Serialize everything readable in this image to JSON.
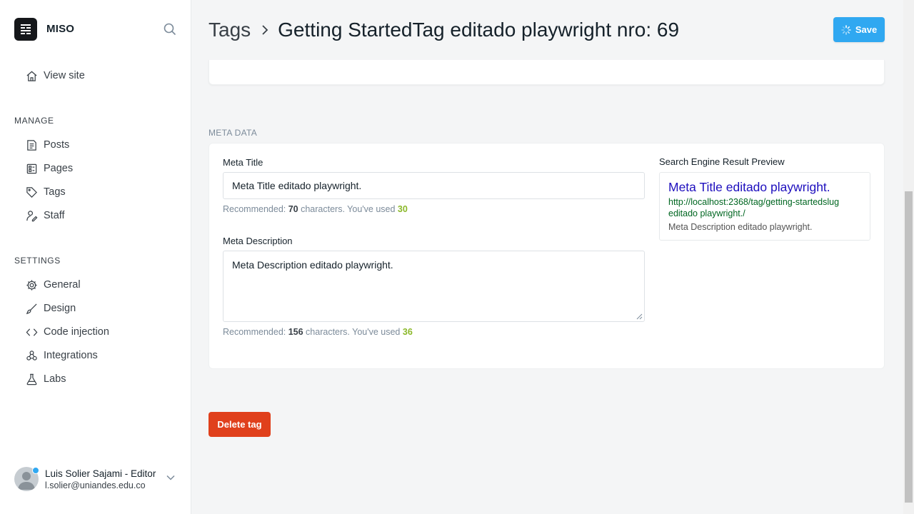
{
  "brand": {
    "name": "MISO"
  },
  "nav": {
    "view_site": "View site",
    "manage_label": "MANAGE",
    "manage_items": [
      "Posts",
      "Pages",
      "Tags",
      "Staff"
    ],
    "settings_label": "SETTINGS",
    "settings_items": [
      "General",
      "Design",
      "Code injection",
      "Integrations",
      "Labs"
    ]
  },
  "user": {
    "name": "Luis Solier Sajami - Editor",
    "email": "l.solier@uniandes.edu.co"
  },
  "header": {
    "crumb": "Tags",
    "title": "Getting StartedTag editado playwright nro: 69",
    "save_label": "Save"
  },
  "meta": {
    "section_label": "META DATA",
    "title_label": "Meta Title",
    "title_value": "Meta Title editado playwright.",
    "title_hint_prefix": "Recommended: ",
    "title_hint_rec": "70",
    "title_hint_mid": " characters. You've used ",
    "title_hint_used": "30",
    "desc_label": "Meta Description",
    "desc_value": "Meta Description editado playwright.",
    "desc_hint_prefix": "Recommended: ",
    "desc_hint_rec": "156",
    "desc_hint_mid": " characters. You've used ",
    "desc_hint_used": "36"
  },
  "preview": {
    "label": "Search Engine Result Preview",
    "title": "Meta Title editado playwright.",
    "url": "http://localhost:2368/tag/getting-startedslug editado playwright./",
    "description": "Meta Description editado playwright."
  },
  "actions": {
    "delete_label": "Delete tag"
  },
  "colors": {
    "primary": "#30a8f1",
    "danger": "#e0401c",
    "success": "#8bb829",
    "serp_title": "#1e0fbe",
    "serp_url": "#006621"
  }
}
